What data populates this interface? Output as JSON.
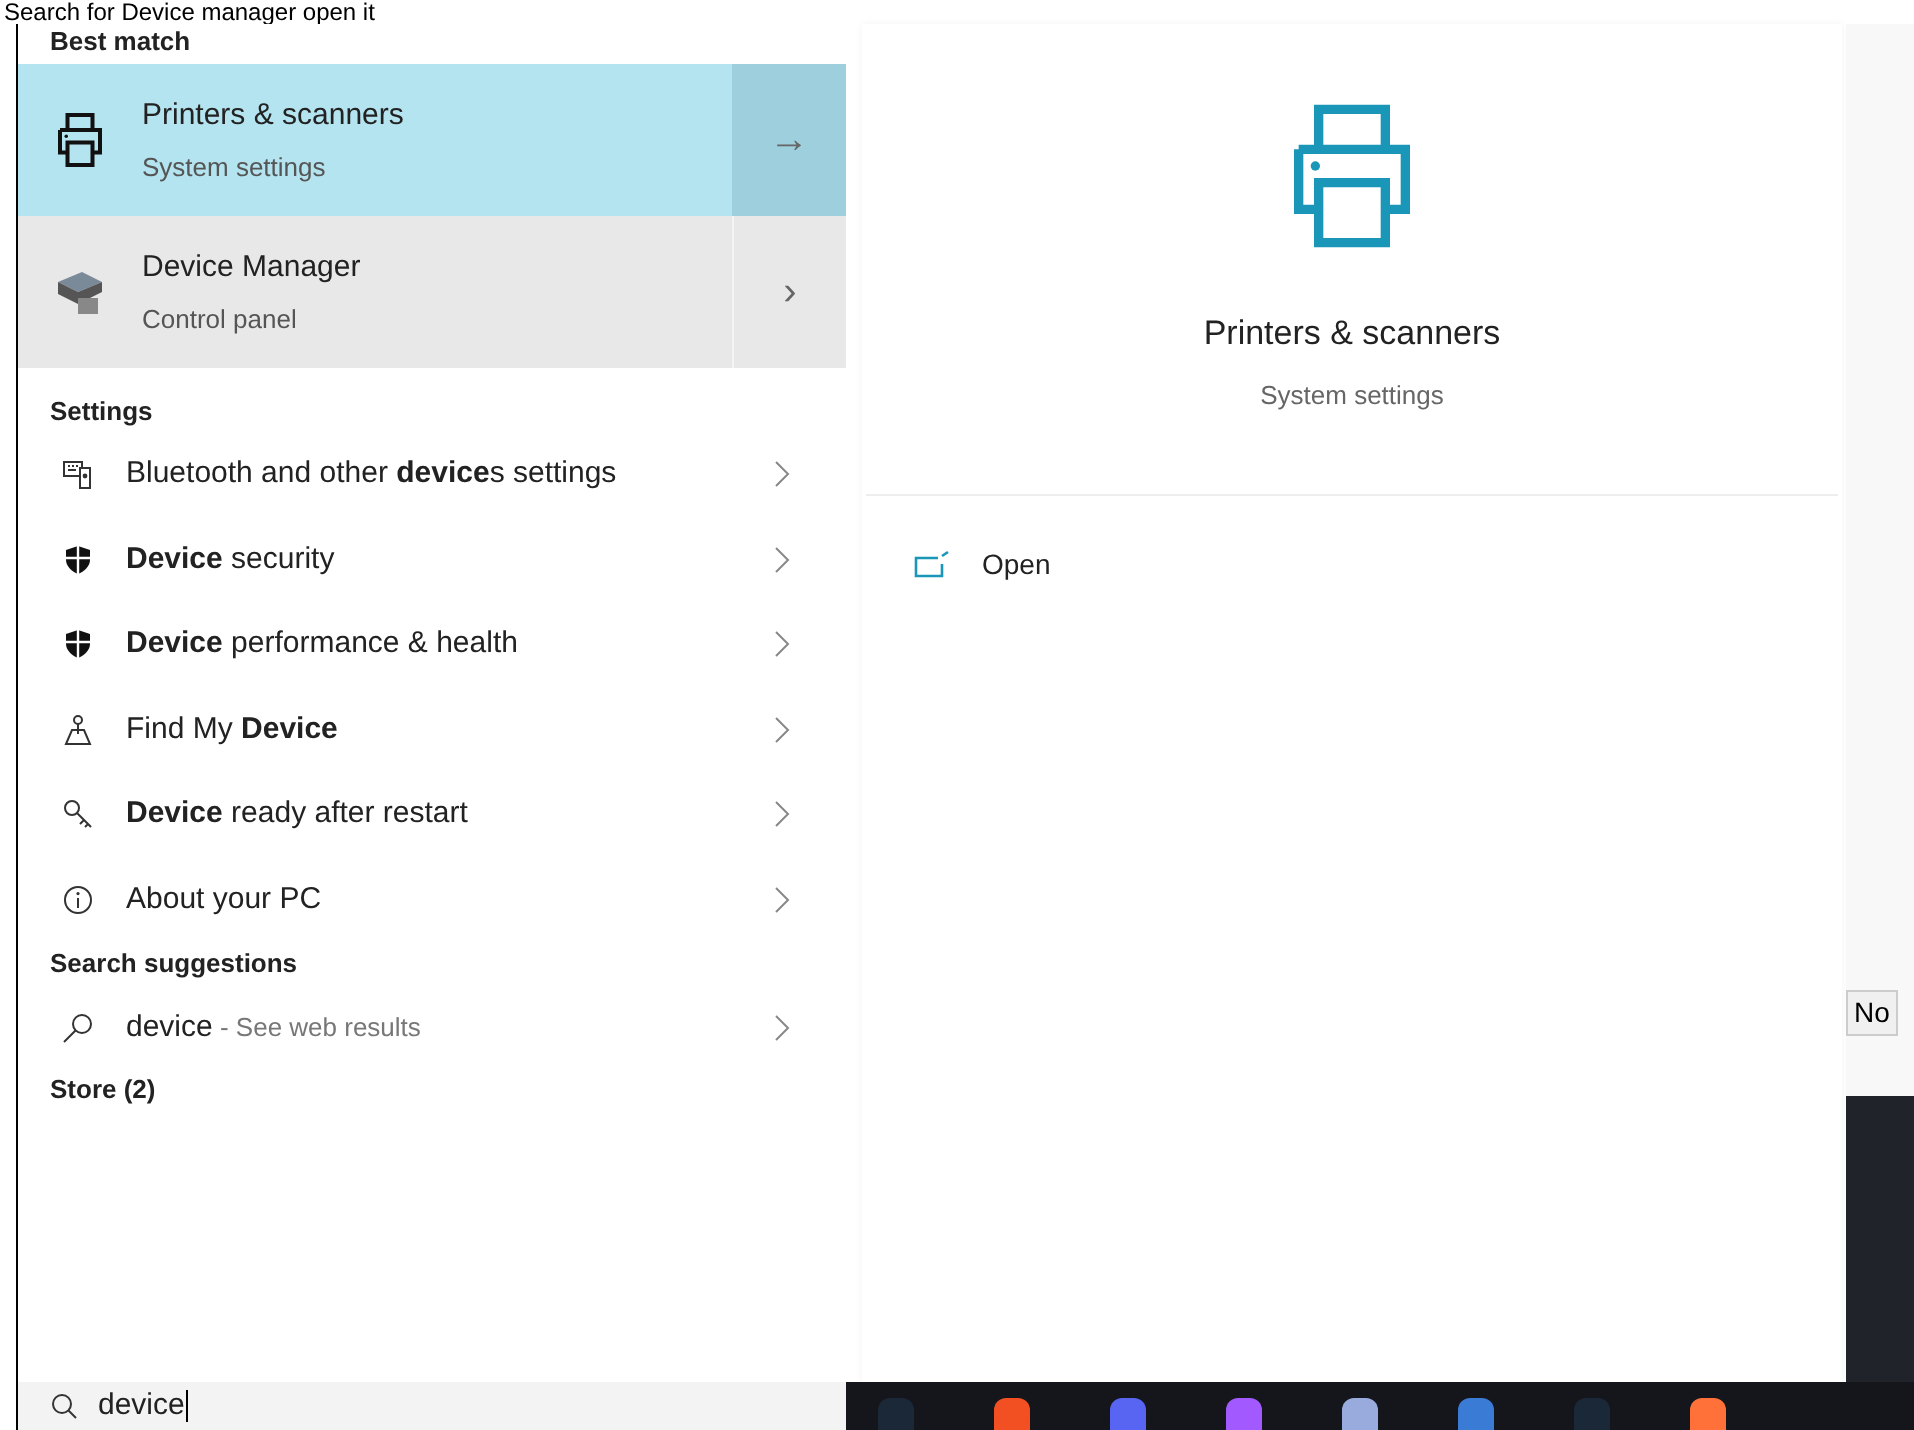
{
  "caption": "Search for Device manager open it",
  "best_match": {
    "heading": "Best match",
    "items": [
      {
        "title": "Printers & scanners",
        "subtitle": "System settings",
        "selected": true,
        "arrow": "→"
      },
      {
        "title": "Device Manager",
        "subtitle": "Control panel",
        "selected": false,
        "arrow": "›"
      }
    ]
  },
  "settings": {
    "heading": "Settings",
    "items": [
      {
        "label": "Bluetooth and other **device**s settings"
      },
      {
        "label": "**Device** security"
      },
      {
        "label": "**Device** performance & health"
      },
      {
        "label": "Find My **Device**"
      },
      {
        "label": "**Device** ready after restart"
      },
      {
        "label": "About your PC"
      }
    ]
  },
  "search_suggestions": {
    "heading": "Search suggestions",
    "items": [
      {
        "query": "device",
        "hint": " - See web results"
      }
    ]
  },
  "store": {
    "heading": "Store (2)"
  },
  "preview": {
    "title": "Printers & scanners",
    "subtitle": "System settings",
    "actions": [
      {
        "label": "Open"
      }
    ]
  },
  "background_window": {
    "text": "No"
  },
  "search_box": {
    "value": "device"
  }
}
